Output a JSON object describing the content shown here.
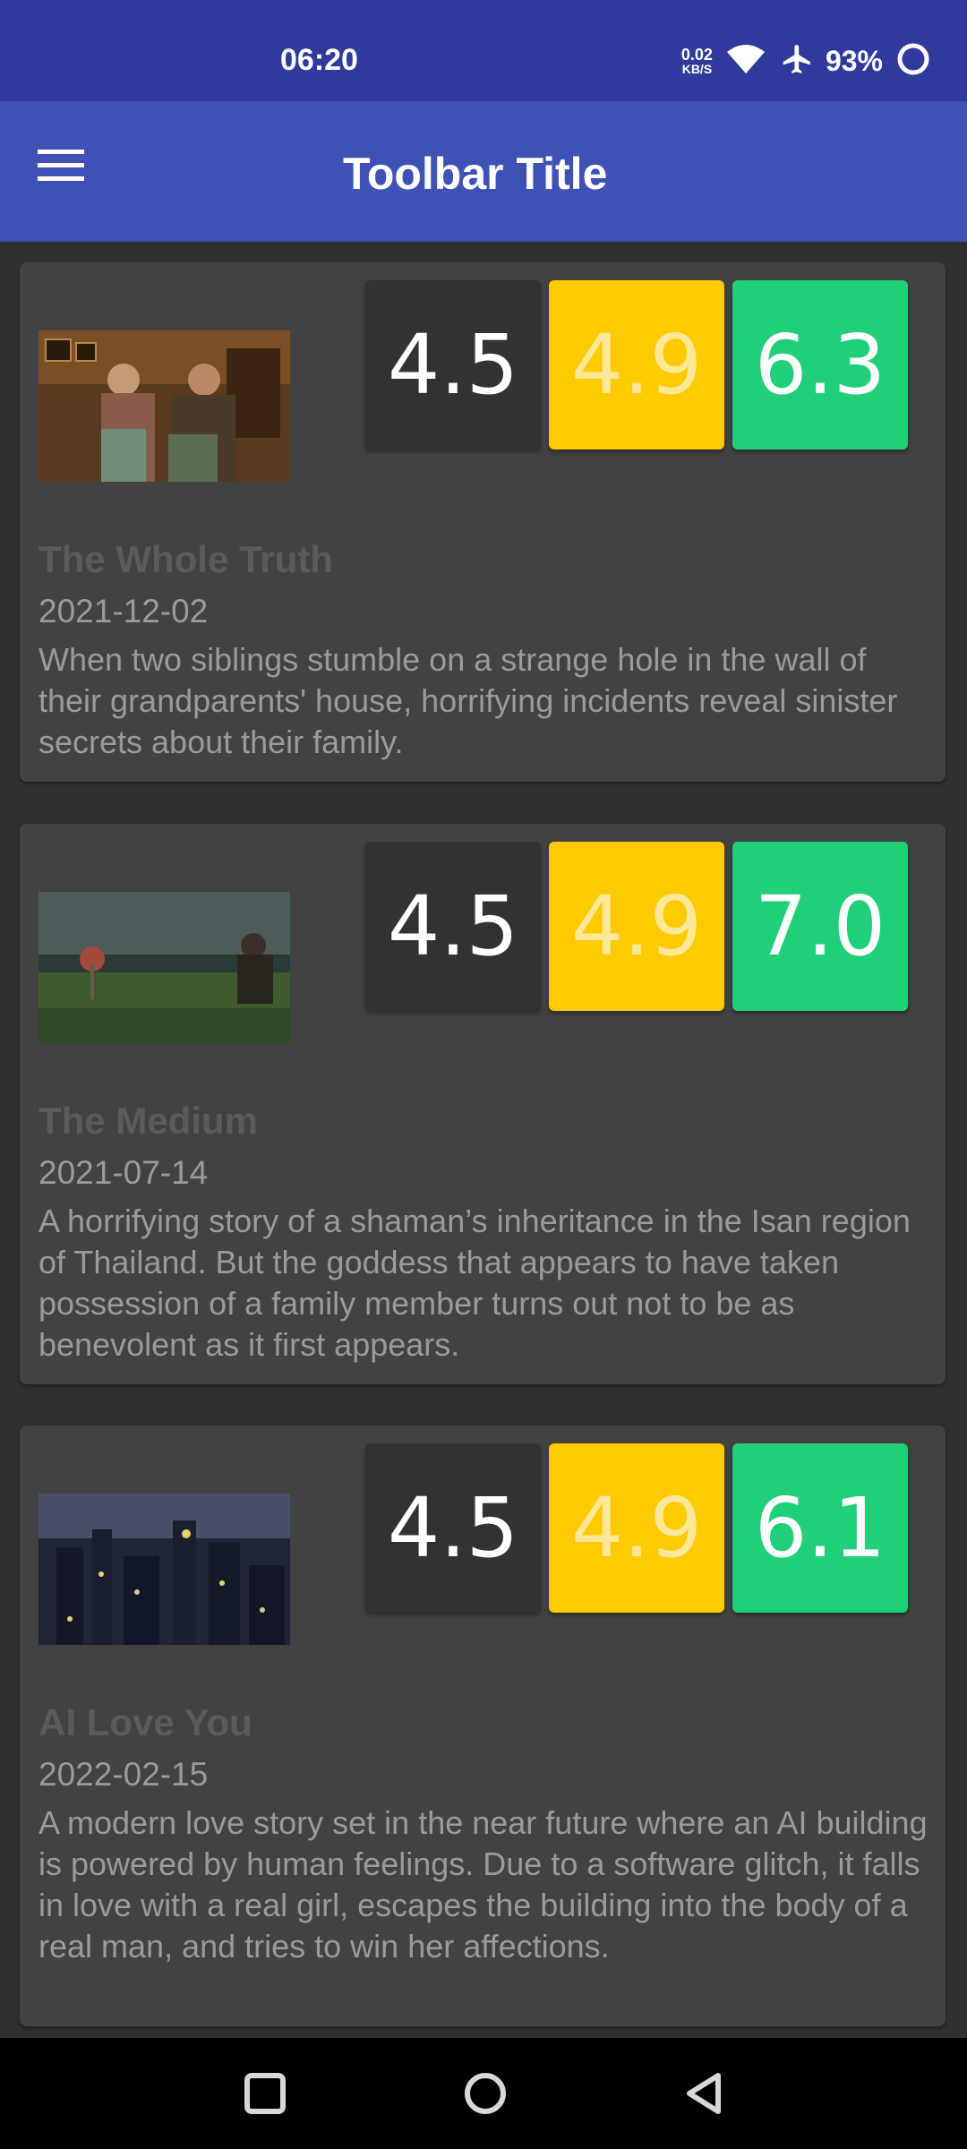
{
  "status_bar": {
    "time": "06:20",
    "net_speed_value": "0.02",
    "net_speed_unit": "KB/S",
    "battery": "93%",
    "icons": [
      "wifi-icon",
      "airplane-mode-icon",
      "battery-ring-icon"
    ]
  },
  "toolbar": {
    "title": "Toolbar Title",
    "menu_icon": "hamburger-menu-icon"
  },
  "colors": {
    "status_bar": "#2f3a9c",
    "toolbar": "#3f51b5",
    "background": "#303030",
    "card": "#424242",
    "rating_dark": "#323232",
    "rating_yellow": "#ffca00",
    "rating_green": "#22cf79"
  },
  "movies": [
    {
      "title": "The Whole Truth",
      "date": "2021-12-02",
      "description": "When two siblings stumble on a strange hole in the wall of their grandparents' house, horrifying incidents reveal sinister secrets about their family.",
      "ratings": [
        "4.5",
        "4.9",
        "6.3"
      ]
    },
    {
      "title": "The Medium",
      "date": "2021-07-14",
      "description": "A horrifying story of a shaman’s inheritance in the Isan region of Thailand. But the goddess that appears to have taken possession of a family member turns out not to be as benevolent as it first appears.",
      "ratings": [
        "4.5",
        "4.9",
        "7.0"
      ]
    },
    {
      "title": "AI Love You",
      "date": "2022-02-15",
      "description": "A modern love story set in the near future where an AI building is powered by human feelings. Due to a software glitch, it falls in love with a real girl, escapes the building into the body of a real man, and tries to win her affections.",
      "ratings": [
        "4.5",
        "4.9",
        "6.1"
      ]
    }
  ],
  "nav_bar": {
    "icons": [
      "recents-square-icon",
      "home-circle-icon",
      "back-triangle-icon"
    ]
  }
}
